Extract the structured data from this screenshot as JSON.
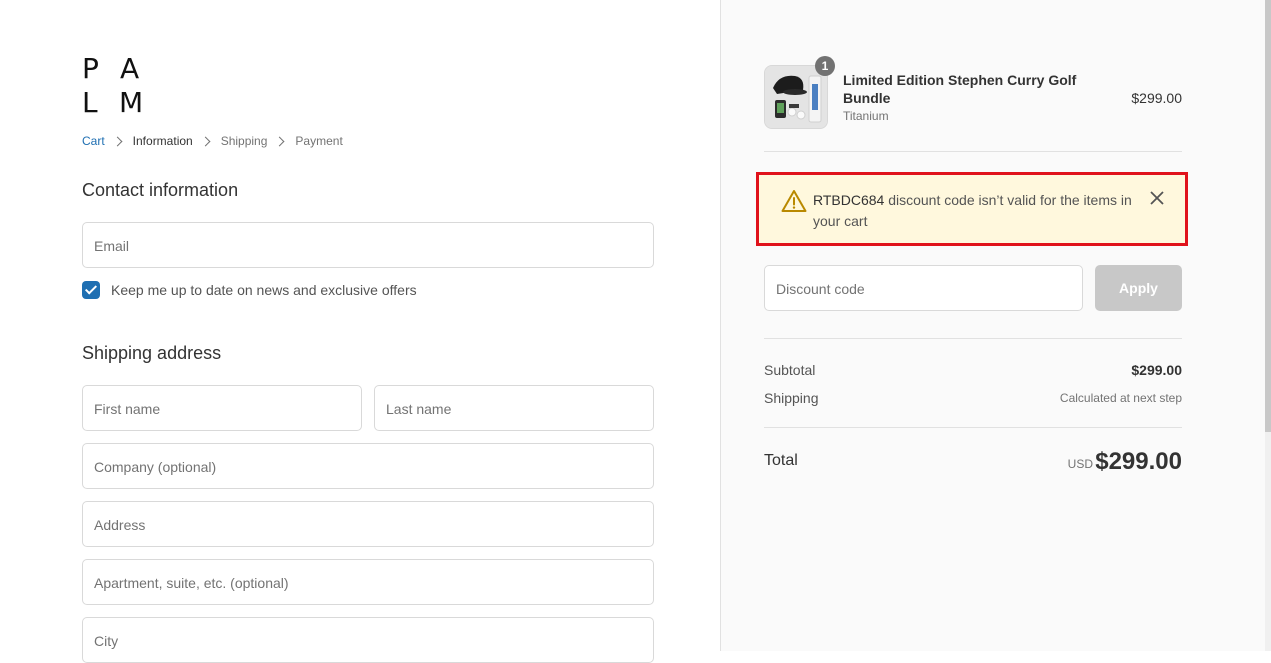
{
  "brand": {
    "logo_letters": [
      "P",
      "A",
      "L",
      "M"
    ]
  },
  "breadcrumb": [
    {
      "label": "Cart",
      "state": "link"
    },
    {
      "label": "Information",
      "state": "active"
    },
    {
      "label": "Shipping",
      "state": "inactive"
    },
    {
      "label": "Payment",
      "state": "inactive"
    }
  ],
  "contact": {
    "title": "Contact information",
    "email_placeholder": "Email",
    "newsletter_label": "Keep me up to date on news and exclusive offers",
    "newsletter_checked": true
  },
  "shipping": {
    "title": "Shipping address",
    "first_name_placeholder": "First name",
    "last_name_placeholder": "Last name",
    "company_placeholder": "Company (optional)",
    "address_placeholder": "Address",
    "apartment_placeholder": "Apartment, suite, etc. (optional)",
    "city_placeholder": "City"
  },
  "order": {
    "product": {
      "name": "Limited Edition Stephen Curry Golf Bundle",
      "variant": "Titanium",
      "price": "$299.00",
      "quantity": "1"
    },
    "alert": {
      "code": "RTBDC684",
      "message": " discount code isn’t valid for the items in your cart"
    },
    "discount": {
      "placeholder": "Discount code",
      "apply_label": "Apply"
    },
    "subtotal_label": "Subtotal",
    "subtotal_value": "$299.00",
    "shipping_label": "Shipping",
    "shipping_value": "Calculated at next step",
    "total_label": "Total",
    "total_currency": "USD",
    "total_value": "$299.00"
  },
  "colors": {
    "link": "#1f6fb2",
    "alert_bg": "#fff8dd",
    "alert_border": "#e0121b",
    "warning_icon": "#b98900",
    "apply_disabled": "#c8c8c8"
  },
  "icons": [
    "warning-icon",
    "close-icon",
    "chevron-right-icon",
    "checkmark-icon"
  ]
}
